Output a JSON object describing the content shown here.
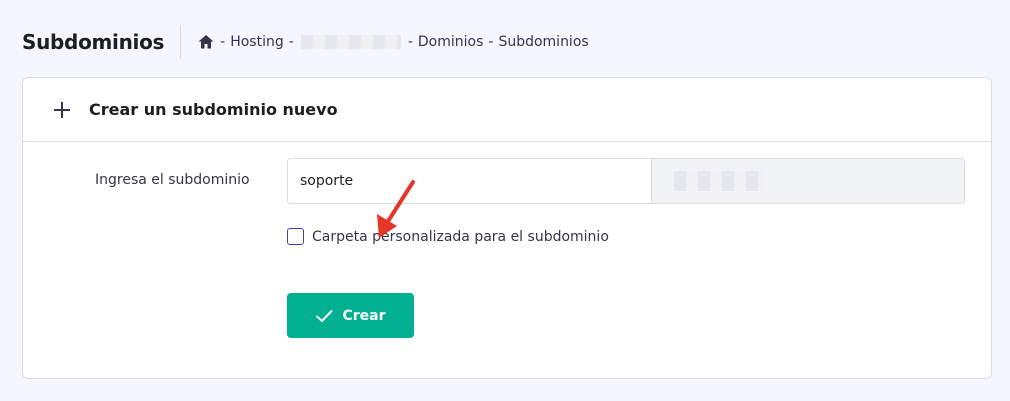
{
  "header": {
    "title": "Subdominios",
    "breadcrumb": {
      "home_icon": "home-icon",
      "items": [
        "Hosting",
        "Dominios",
        "Subdominios"
      ],
      "separator": "-"
    }
  },
  "card": {
    "icon": "plus-icon",
    "title": "Crear un subdominio nuevo"
  },
  "form": {
    "label": "Ingresa el subdominio",
    "subdomain_value": "soporte",
    "checkbox_label": "Carpeta personalizada para el subdominio",
    "checkbox_checked": false,
    "create_button_label": "Crear"
  },
  "colors": {
    "accent": "#00b090",
    "checkbox_border": "#4c3aa6",
    "annotation_arrow": "#e5362a"
  }
}
